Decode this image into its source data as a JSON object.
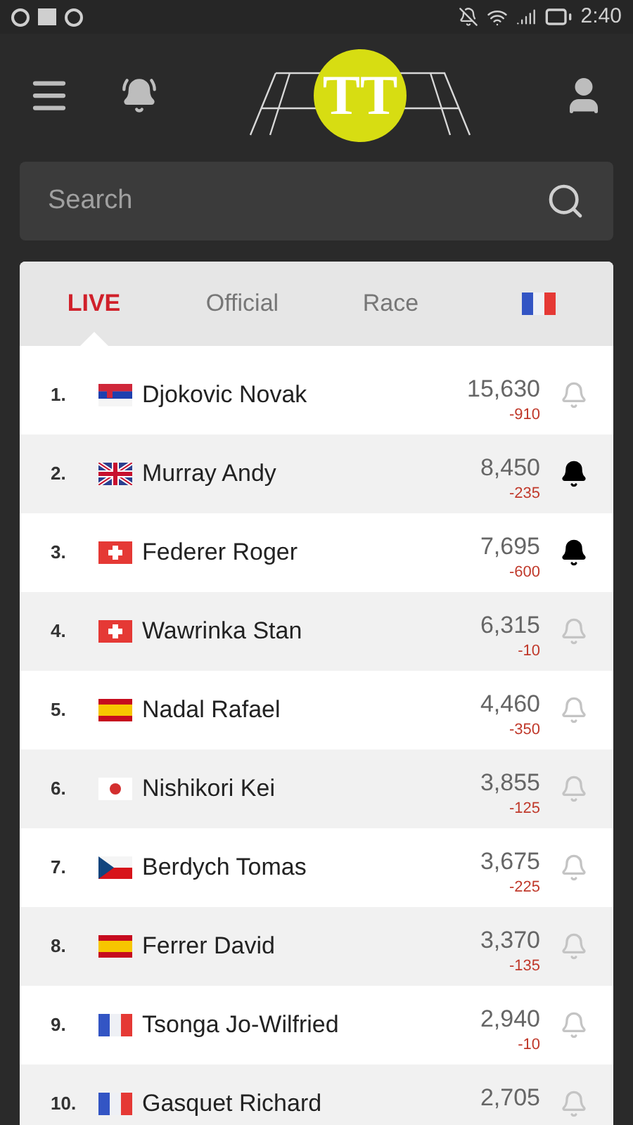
{
  "status_bar": {
    "time": "2:40"
  },
  "header": {
    "logo_text": "TT"
  },
  "search": {
    "placeholder": "Search"
  },
  "tabs": [
    {
      "label": "LIVE",
      "selected": true
    },
    {
      "label": "Official",
      "selected": false
    },
    {
      "label": "Race",
      "selected": false
    },
    {
      "kind": "fr",
      "selected": false
    }
  ],
  "rankings": [
    {
      "rank": "1.",
      "kind": "rs",
      "name": "Djokovic Novak",
      "points": "15,630",
      "change": "-910",
      "alert": false
    },
    {
      "rank": "2.",
      "kind": "gb",
      "name": "Murray Andy",
      "points": "8,450",
      "change": "-235",
      "alert": true
    },
    {
      "rank": "3.",
      "kind": "ch",
      "name": "Federer Roger",
      "points": "7,695",
      "change": "-600",
      "alert": true
    },
    {
      "rank": "4.",
      "kind": "ch",
      "name": "Wawrinka Stan",
      "points": "6,315",
      "change": "-10",
      "alert": false
    },
    {
      "rank": "5.",
      "kind": "es",
      "name": "Nadal Rafael",
      "points": "4,460",
      "change": "-350",
      "alert": false
    },
    {
      "rank": "6.",
      "kind": "jp",
      "name": "Nishikori Kei",
      "points": "3,855",
      "change": "-125",
      "alert": false
    },
    {
      "rank": "7.",
      "kind": "cz",
      "name": "Berdych Tomas",
      "points": "3,675",
      "change": "-225",
      "alert": false
    },
    {
      "rank": "8.",
      "kind": "es",
      "name": "Ferrer David",
      "points": "3,370",
      "change": "-135",
      "alert": false
    },
    {
      "rank": "9.",
      "kind": "fr",
      "name": "Tsonga Jo-Wilfried",
      "points": "2,940",
      "change": "-10",
      "alert": false
    },
    {
      "rank": "10.",
      "kind": "fr",
      "name": "Gasquet Richard",
      "points": "2,705",
      "alert": false
    }
  ]
}
